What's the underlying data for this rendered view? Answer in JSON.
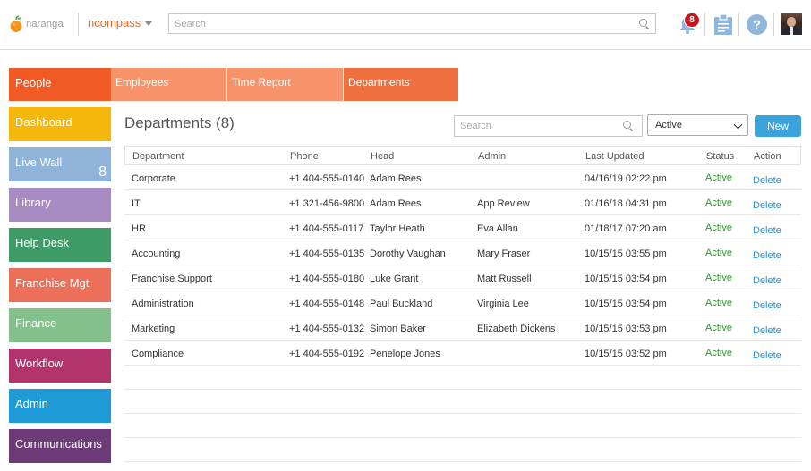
{
  "header": {
    "logo_text": "naranga",
    "app_name": "ncompass",
    "search_placeholder": "Search",
    "notifications_count": "8"
  },
  "sidebar": {
    "items": [
      {
        "label": "People",
        "color": "#f05a24"
      },
      {
        "label": "Dashboard",
        "color": "#f5b70a"
      },
      {
        "label": "Live Wall",
        "color": "#8fb3d9",
        "count": "8"
      },
      {
        "label": "Library",
        "color": "#a98bc4"
      },
      {
        "label": "Help Desk",
        "color": "#3f9b66"
      },
      {
        "label": "Franchise Mgt",
        "color": "#ec6f5a"
      },
      {
        "label": "Finance",
        "color": "#84c08b"
      },
      {
        "label": "Workflow",
        "color": "#b3336b"
      },
      {
        "label": "Admin",
        "color": "#1e9ad6"
      },
      {
        "label": "Communications",
        "color": "#6e3b78"
      }
    ]
  },
  "subtabs": [
    {
      "label": "Employees",
      "color": "#f6936b"
    },
    {
      "label": "Time Report",
      "color": "#f6936b"
    },
    {
      "label": "Departments",
      "color": "#f06f3e"
    }
  ],
  "main": {
    "title": "Departments (8)",
    "search_placeholder": "Search",
    "status_filter": "Active",
    "new_label": "New",
    "columns": [
      "Department",
      "Phone",
      "Head",
      "Admin",
      "Last Updated",
      "Status",
      "Action"
    ],
    "rows": [
      {
        "department": "Corporate",
        "phone": "+1 404-555-0140",
        "head": "Adam Rees",
        "admin": "",
        "updated": "04/16/19 02:22 pm",
        "status": "Active",
        "action": "Delete"
      },
      {
        "department": "IT",
        "phone": "+1 321-456-9800",
        "head": "Adam Rees",
        "admin": "App Review",
        "updated": "01/16/18 04:31 pm",
        "status": "Active",
        "action": "Delete"
      },
      {
        "department": "HR",
        "phone": "+1 404-555-0117",
        "head": "Taylor Heath",
        "admin": "Eva Allan",
        "updated": "01/18/17 07:20 am",
        "status": "Active",
        "action": "Delete"
      },
      {
        "department": "Accounting",
        "phone": "+1 404-555-0135",
        "head": "Dorothy Vaughan",
        "admin": "Mary Fraser",
        "updated": "10/15/15 03:55 pm",
        "status": "Active",
        "action": "Delete"
      },
      {
        "department": "Franchise Support",
        "phone": "+1 404-555-0180",
        "head": "Luke Grant",
        "admin": "Matt Russell",
        "updated": "10/15/15 03:54 pm",
        "status": "Active",
        "action": "Delete"
      },
      {
        "department": "Administration",
        "phone": "+1 404-555-0148",
        "head": "Paul Buckland",
        "admin": "Virginia Lee",
        "updated": "10/15/15 03:54 pm",
        "status": "Active",
        "action": "Delete"
      },
      {
        "department": "Marketing",
        "phone": "+1 404-555-0132",
        "head": "Simon Baker",
        "admin": "Elizabeth Dickens",
        "updated": "10/15/15 03:53 pm",
        "status": "Active",
        "action": "Delete"
      },
      {
        "department": "Compliance",
        "phone": "+1 404-555-0192",
        "head": "Penelope Jones",
        "admin": "",
        "updated": "10/15/15 03:52 pm",
        "status": "Active",
        "action": "Delete"
      }
    ]
  },
  "icons": {
    "logo": "orange-logo-icon",
    "search": "search-icon",
    "notifications": "bell-icon",
    "tasks": "clipboard-icon",
    "help": "help-icon",
    "user": "avatar"
  }
}
